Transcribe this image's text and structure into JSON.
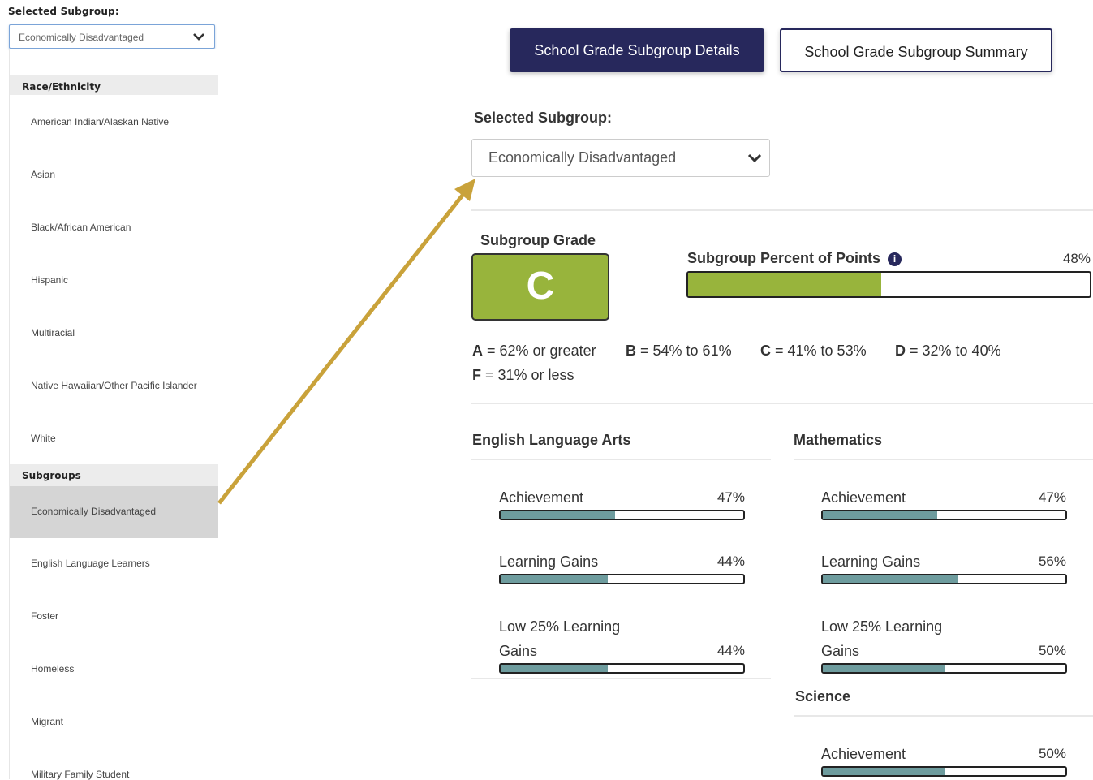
{
  "left_panel": {
    "label": "Selected Subgroup:",
    "selected": "Economically Disadvantaged",
    "groups": [
      {
        "header": "Race/Ethnicity",
        "items": [
          "American Indian/Alaskan Native",
          "Asian",
          "Black/African American",
          "Hispanic",
          "Multiracial",
          "Native Hawaiian/Other Pacific Islander",
          "White"
        ]
      },
      {
        "header": "Subgroups",
        "items": [
          "Economically Disadvantaged",
          "English Language Learners",
          "Foster",
          "Homeless",
          "Migrant",
          "Military Family Student"
        ]
      }
    ]
  },
  "tabs": {
    "details": "School Grade Subgroup Details",
    "summary": "School Grade Subgroup Summary"
  },
  "selector": {
    "label": "Selected Subgroup:",
    "value": "Economically Disadvantaged"
  },
  "grade": {
    "label": "Subgroup Grade",
    "value": "C",
    "color": "#98b43c"
  },
  "percent_points": {
    "label": "Subgroup Percent of Points",
    "info_icon": "info-icon",
    "value_text": "48%",
    "value": 0.48
  },
  "scale": {
    "a": {
      "letter": "A",
      "text": " = 62% or greater"
    },
    "b": {
      "letter": "B",
      "text": " = 54% to 61%"
    },
    "c": {
      "letter": "C",
      "text": " = 41% to 53%"
    },
    "d": {
      "letter": "D",
      "text": " = 32% to 40%"
    },
    "f": {
      "letter": "F",
      "text": " = 31% or less"
    }
  },
  "ela": {
    "title": "English Language Arts",
    "metrics": [
      {
        "label": "Achievement",
        "value_text": "47%",
        "value": 0.47
      },
      {
        "label": "Learning Gains",
        "value_text": "44%",
        "value": 0.44
      },
      {
        "label_line1": "Low 25% Learning",
        "label_line2": "Gains",
        "value_text": "44%",
        "value": 0.44
      }
    ]
  },
  "math": {
    "title": "Mathematics",
    "metrics": [
      {
        "label": "Achievement",
        "value_text": "47%",
        "value": 0.47
      },
      {
        "label": "Learning Gains",
        "value_text": "56%",
        "value": 0.56
      },
      {
        "label_line1": "Low 25% Learning",
        "label_line2": "Gains",
        "value_text": "50%",
        "value": 0.5
      }
    ]
  },
  "science": {
    "title": "Science",
    "metrics": [
      {
        "label": "Achievement",
        "value_text": "50%",
        "value": 0.5
      }
    ]
  },
  "colors": {
    "navy": "#27285c",
    "grade_green": "#98b43c",
    "metric_teal": "#6e9c9e",
    "arrow": "#c9a23a"
  }
}
